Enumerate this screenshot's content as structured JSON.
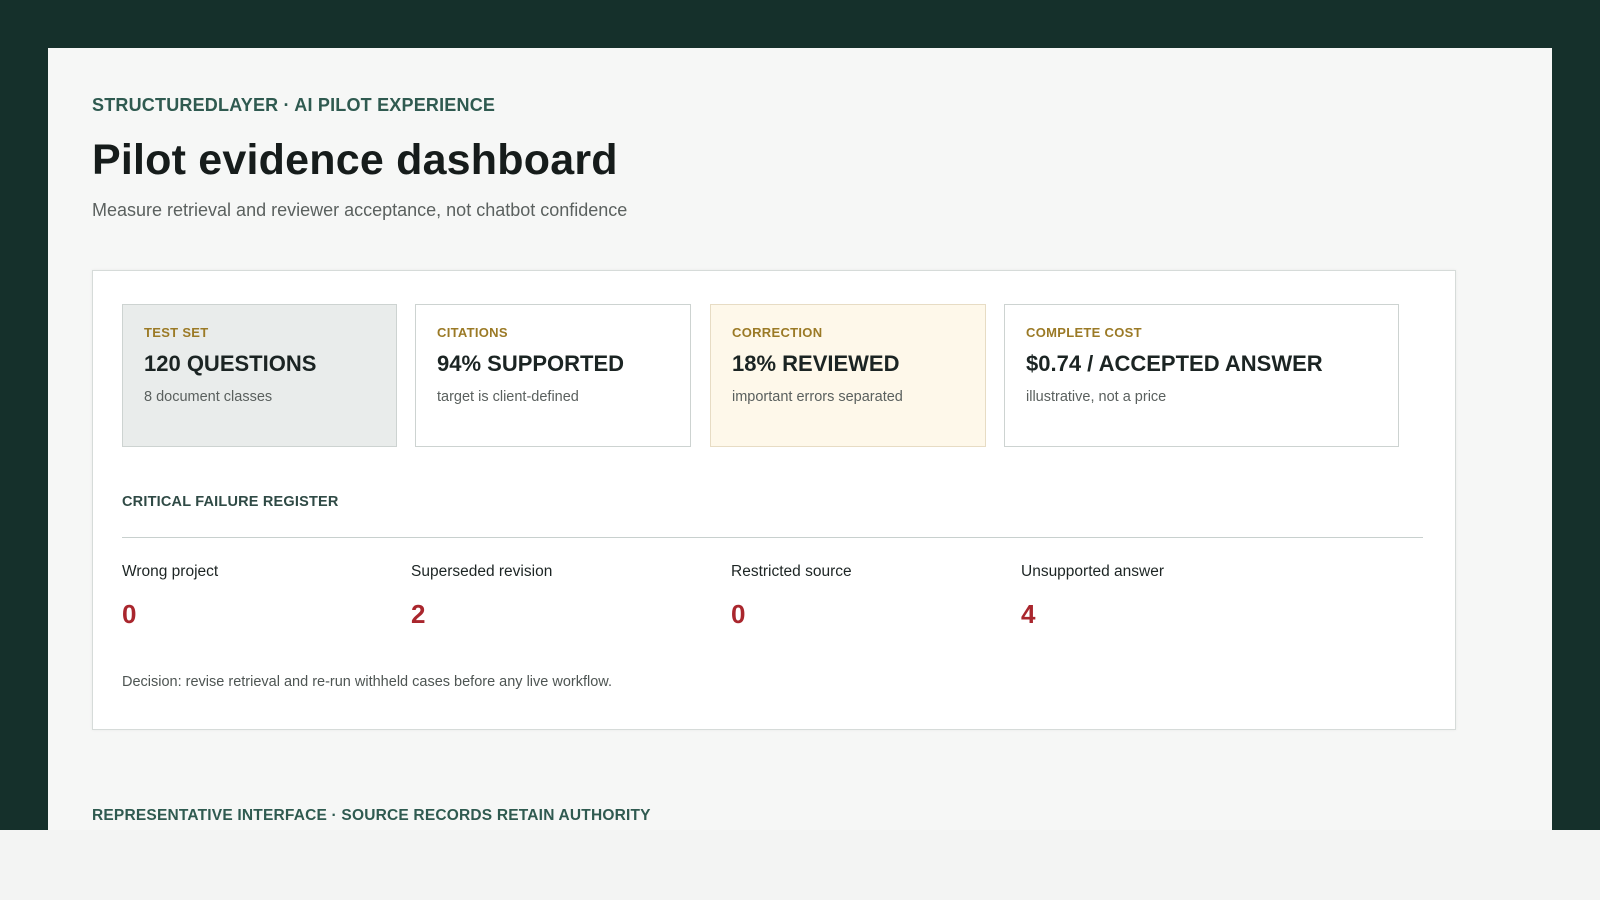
{
  "header": {
    "eyebrow": "STRUCTUREDLAYER · AI PILOT EXPERIENCE",
    "title": "Pilot evidence dashboard",
    "subtitle": "Measure retrieval and reviewer acceptance, not chatbot confidence"
  },
  "metrics": [
    {
      "label": "TEST SET",
      "value": "120 QUESTIONS",
      "note": "8 document classes"
    },
    {
      "label": "CITATIONS",
      "value": "94% SUPPORTED",
      "note": "target is client-defined"
    },
    {
      "label": "CORRECTION",
      "value": "18% REVIEWED",
      "note": "important errors separated"
    },
    {
      "label": "COMPLETE COST",
      "value": "$0.74 / ACCEPTED ANSWER",
      "note": "illustrative, not a price"
    }
  ],
  "register": {
    "title": "CRITICAL FAILURE REGISTER",
    "items": [
      {
        "label": "Wrong project",
        "count": "0"
      },
      {
        "label": "Superseded revision",
        "count": "2"
      },
      {
        "label": "Restricted source",
        "count": "0"
      },
      {
        "label": "Unsupported answer",
        "count": "4"
      }
    ],
    "decision": "Decision: revise retrieval and re-run withheld cases before any live workflow."
  },
  "footer": {
    "note": "REPRESENTATIVE INTERFACE · SOURCE RECORDS RETAIN AUTHORITY"
  },
  "colors": {
    "frame": "#15302b",
    "accent": "#2f5a50",
    "card_label": "#9b7a26",
    "failure_count": "#a9262d",
    "warm_card": "#fef8ea",
    "muted_card": "#e9eceb"
  }
}
